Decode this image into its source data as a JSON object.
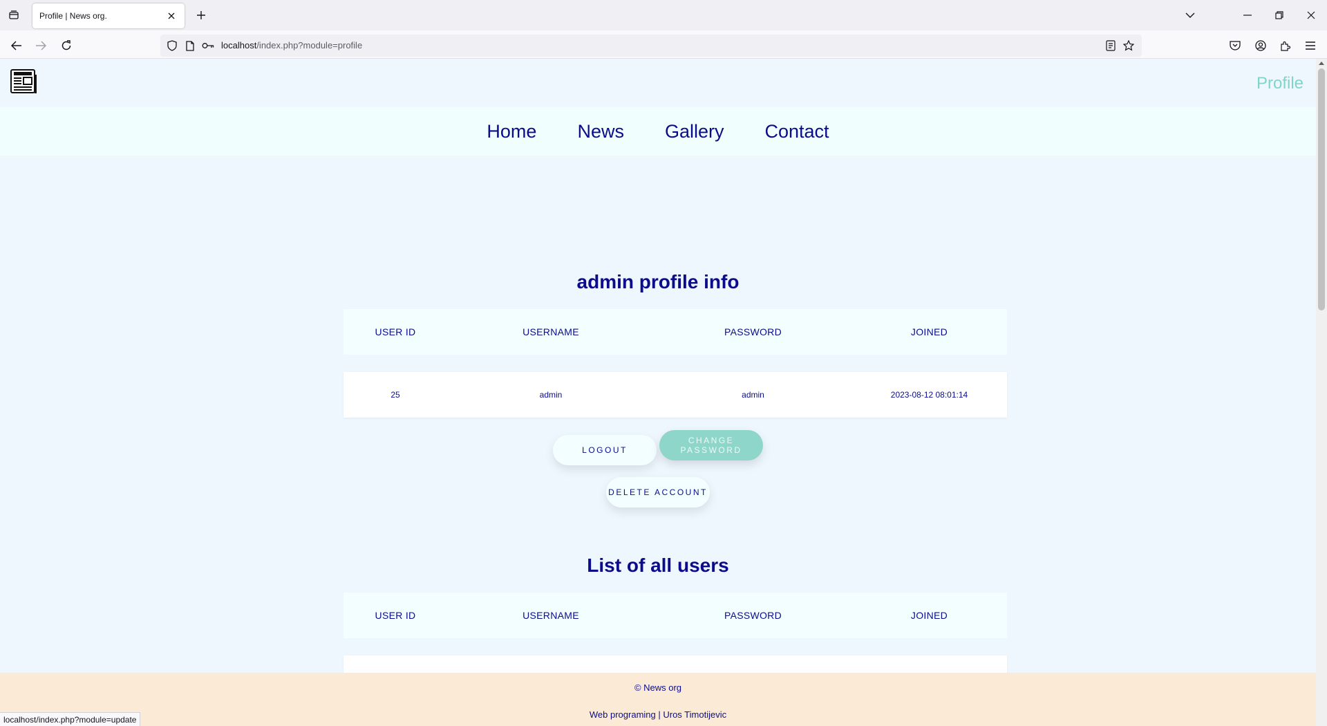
{
  "browser": {
    "tab_title": "Profile | News org.",
    "url_host": "localhost",
    "url_path": "/index.php?module=profile",
    "status_url": "localhost/index.php?module=update"
  },
  "site": {
    "profile_link": "Profile",
    "nav": [
      "Home",
      "News",
      "Gallery",
      "Contact"
    ]
  },
  "profile": {
    "title": "admin profile info",
    "columns": [
      "USER ID",
      "USERNAME",
      "PASSWORD",
      "JOINED"
    ],
    "row": {
      "user_id": "25",
      "username": "admin",
      "password": "admin",
      "joined": "2023-08-12 08:01:14"
    },
    "buttons": {
      "logout": "LOGOUT",
      "change_password": "CHANGE PASSWORD",
      "delete_account": "DELETE ACCOUNT"
    }
  },
  "users": {
    "title": "List of all users",
    "columns": [
      "USER ID",
      "USERNAME",
      "PASSWORD",
      "JOINED"
    ]
  },
  "footer": {
    "copyright": "© News org",
    "credit": "Web programing | Uros Timotijevic"
  },
  "colors": {
    "navy": "#0c0c8a",
    "teal": "#8fd6ca",
    "page_bg": "#eef6fe",
    "footer_bg": "#faead6"
  }
}
